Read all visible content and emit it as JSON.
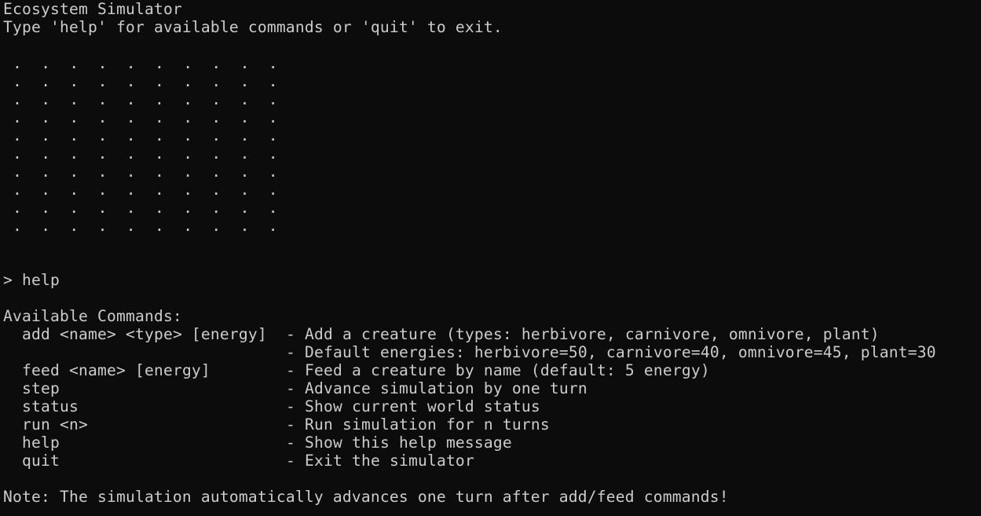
{
  "terminal": {
    "title_line": "Ecosystem Simulator",
    "intro_line": "Type 'help' for available commands or 'quit' to exit.",
    "grid": {
      "rows": 10,
      "cols": 10,
      "cell_char": "."
    },
    "prompt_line": "> help",
    "commands_header": "Available Commands:",
    "commands": [
      {
        "usage": "add <name> <type> [energy]",
        "description": "- Add a creature (types: herbivore, carnivore, omnivore, plant)"
      },
      {
        "usage": "",
        "description": "- Default energies: herbivore=50, carnivore=40, omnivore=45, plant=30"
      },
      {
        "usage": "feed <name> [energy]",
        "description": "- Feed a creature by name (default: 5 energy)"
      },
      {
        "usage": "step",
        "description": "- Advance simulation by one turn"
      },
      {
        "usage": "status",
        "description": "- Show current world status"
      },
      {
        "usage": "run <n>",
        "description": "- Run simulation for n turns"
      },
      {
        "usage": "help",
        "description": "- Show this help message"
      },
      {
        "usage": "quit",
        "description": "- Exit the simulator"
      }
    ],
    "note_line": "Note: The simulation automatically advances one turn after add/feed commands!"
  },
  "colors": {
    "background": "#0c0c0c",
    "foreground": "#cccccc"
  }
}
